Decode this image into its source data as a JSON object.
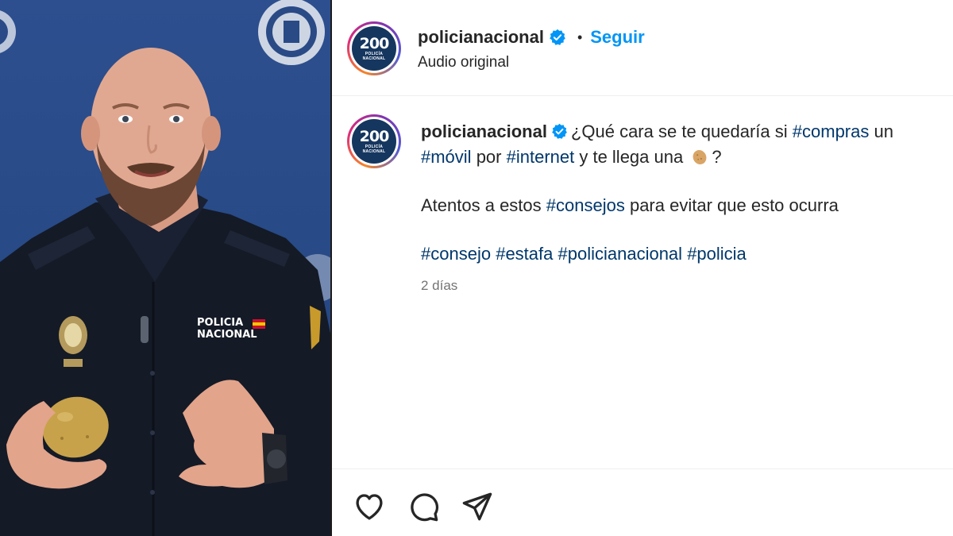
{
  "post": {
    "username": "policianacional",
    "verified": true,
    "separator": "•",
    "follow_label": "Seguir",
    "audio_label": "Audio original"
  },
  "avatar": {
    "number": "200",
    "subtitle_1": "POLICÍA",
    "subtitle_2": "NACIONAL"
  },
  "caption": {
    "username": "policianacional",
    "line1_a": "¿Qué cara se te quedaría si ",
    "tag_compras": "#compras",
    "line1_b": " un ",
    "tag_movil": "#móvil",
    "line1_c": " por ",
    "tag_internet": "#internet",
    "line1_d": " y te llega una ",
    "emoji": "potato-emoji",
    "line1_e": "?",
    "line2_a": "Atentos a estos ",
    "tag_consejos": "#consejos",
    "line2_b": " para evitar que esto ocurra",
    "hashtags": [
      "#consejo",
      "#estafa",
      "#policianacional",
      "#policia"
    ],
    "timestamp": "2 días"
  },
  "media": {
    "uniform_text_1": "POLICIA",
    "uniform_text_2": "NACIONAL"
  },
  "actions": {
    "icons": [
      "heart-icon",
      "comment-icon",
      "share-icon"
    ]
  },
  "colors": {
    "link": "#0095f6",
    "hashtag": "#00376b",
    "verified": "#0095f6",
    "muted": "#737373"
  }
}
